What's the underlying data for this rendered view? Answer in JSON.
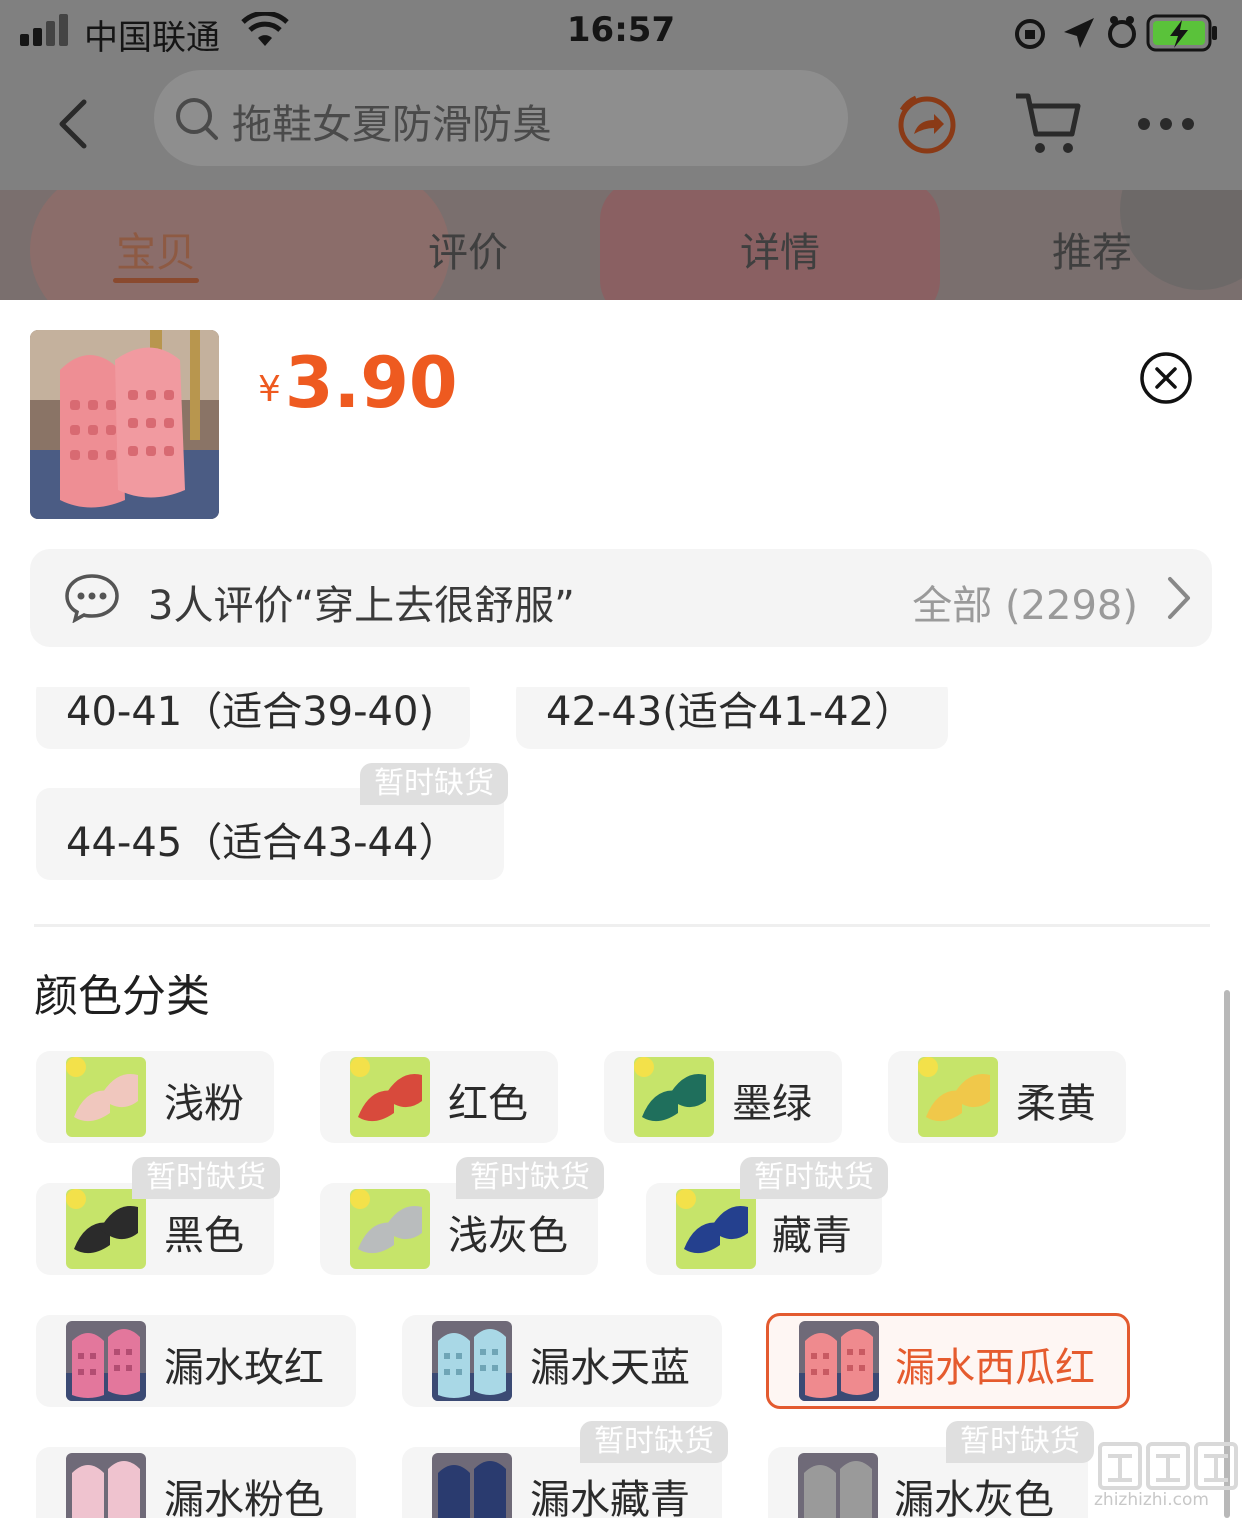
{
  "status_bar": {
    "carrier": "中国联通",
    "time": "16:57"
  },
  "search": {
    "placeholder": "拖鞋女夏防滑防臭"
  },
  "tabs": [
    {
      "label": "宝贝"
    },
    {
      "label": "评价"
    },
    {
      "label": "详情"
    },
    {
      "label": "推荐"
    }
  ],
  "product": {
    "currency": "¥",
    "price": "3.90"
  },
  "review": {
    "summary": "3人评价“穿上去很舒服”",
    "all_label": "全部 (2298)"
  },
  "sizes": [
    {
      "label": "40-41（适合39-40)"
    },
    {
      "label": "42-43(适合41-42）"
    },
    {
      "label": "44-45（适合43-44）",
      "badge": "暂时缺货"
    }
  ],
  "color_section": {
    "title": "颜色分类"
  },
  "colors": [
    {
      "label": "浅粉",
      "swatch": "#f0c7be"
    },
    {
      "label": "红色",
      "swatch": "#d84a3c"
    },
    {
      "label": "墨绿",
      "swatch": "#1f6f5c"
    },
    {
      "label": "柔黄",
      "swatch": "#f0c84a"
    },
    {
      "label": "黑色",
      "swatch": "#2b2b2b",
      "badge": "暂时缺货"
    },
    {
      "label": "浅灰色",
      "swatch": "#b9bcbd",
      "badge": "暂时缺货"
    },
    {
      "label": "藏青",
      "swatch": "#24408e",
      "badge": "暂时缺货"
    },
    {
      "label": "漏水玫红",
      "swatch": "#e3779c"
    },
    {
      "label": "漏水天蓝",
      "swatch": "#a9d8e6"
    },
    {
      "label": "漏水西瓜红",
      "swatch": "#ef8a8e",
      "selected": true
    },
    {
      "label": "漏水粉色",
      "swatch": "#efc3cf"
    },
    {
      "label": "漏水藏青",
      "swatch": "#2a3b6f",
      "badge": "暂时缺货"
    },
    {
      "label": "漏水灰色",
      "swatch": "#9a9a9a",
      "badge": "暂时缺货"
    }
  ],
  "watermark": {
    "url": "zhizhizhi.com"
  },
  "colors_theme": {
    "accent": "#ee5a20",
    "selected_border": "#e35a2f"
  }
}
